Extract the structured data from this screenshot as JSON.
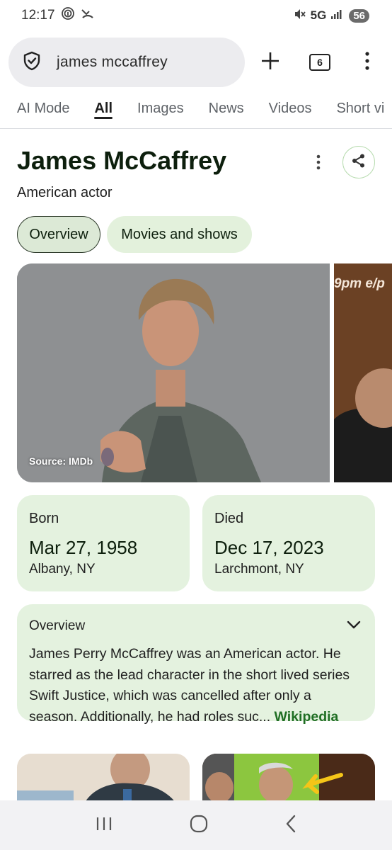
{
  "status_bar": {
    "time": "12:17",
    "network": "5G",
    "battery": "56"
  },
  "search": {
    "query": "james mccaffrey",
    "tab_count": "6"
  },
  "result_tabs": [
    {
      "label": "AI Mode"
    },
    {
      "label": "All"
    },
    {
      "label": "Images"
    },
    {
      "label": "News"
    },
    {
      "label": "Videos"
    },
    {
      "label": "Short vi"
    }
  ],
  "knowledge_panel": {
    "title": "James McCaffrey",
    "subtitle": "American actor",
    "chips": [
      {
        "label": "Overview"
      },
      {
        "label": "Movies and shows"
      }
    ],
    "image_source": "Source: IMDb",
    "side_image_text": "9pm e/p",
    "born": {
      "label": "Born",
      "date": "Mar 27, 1958",
      "place": "Albany, NY"
    },
    "died": {
      "label": "Died",
      "date": "Dec 17, 2023",
      "place": "Larchmont, NY"
    },
    "overview": {
      "heading": "Overview",
      "text": "James Perry McCaffrey was an American actor. He starred as the lead character in the short lived series Swift Justice, which was cancelled after only a season. Additionally, he had roles suc",
      "ellipsis": "...",
      "link": "Wikipedia"
    }
  },
  "colors": {
    "accent_green": "#1f6e23",
    "card_bg": "#e4f2df",
    "chip_selected": "#dce9d6"
  }
}
